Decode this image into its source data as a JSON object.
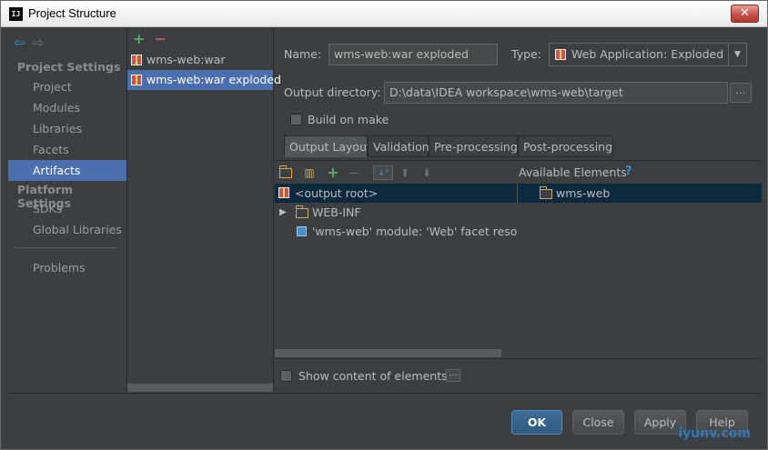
{
  "window": {
    "title": "Project Structure",
    "app_icon_text": "IJ",
    "close_glyph": "✕"
  },
  "nav": {
    "back_glyph": "⇦",
    "forward_glyph": "⇨",
    "project_settings_header": "Project Settings",
    "project_settings_items": [
      "Project",
      "Modules",
      "Libraries",
      "Facets",
      "Artifacts"
    ],
    "platform_settings_header": "Platform Settings",
    "platform_settings_items": [
      "SDKs",
      "Global Libraries"
    ],
    "other_items": [
      "Problems"
    ],
    "selected": "Artifacts"
  },
  "artifacts": {
    "add_glyph": "+",
    "remove_glyph": "−",
    "items": [
      "wms-web:war",
      "wms-web:war exploded"
    ],
    "selected": "wms-web:war exploded"
  },
  "form": {
    "name_label": "Name:",
    "name_value": "wms-web:war exploded",
    "type_label": "Type:",
    "type_value": "Web Application: Exploded",
    "type_dropdown_glyph": "▼",
    "output_dir_label": "Output directory:",
    "output_dir_value": "D:\\data\\IDEA workspace\\wms-web\\target",
    "browse_glyph": "...",
    "build_on_make_label": "Build on make",
    "build_on_make_checked": false
  },
  "tabs": [
    "Output Layout",
    "Validation",
    "Pre-processing",
    "Post-processing"
  ],
  "active_tab": "Output Layout",
  "layout_toolbar": {
    "icons": [
      "new-folder-icon",
      "archive-icon",
      "add-icon",
      "remove-icon",
      "sort-icon",
      "move-up-icon",
      "move-down-icon"
    ],
    "add_glyph": "+",
    "remove_glyph": "—",
    "sort_glyph": "↓ᶻ",
    "up_glyph": "⬆",
    "down_glyph": "⬇",
    "available_label": "Available Elements",
    "help_glyph": "?"
  },
  "output_tree": [
    {
      "label": "<output root>",
      "icon": "artifact-icon",
      "selected": true
    },
    {
      "label": "WEB-INF",
      "icon": "folder-icon",
      "expand_glyph": "▶"
    },
    {
      "label": "'wms-web' module: 'Web' facet resour",
      "icon": "web-facet-icon"
    }
  ],
  "available_tree": [
    {
      "label": "wms-web",
      "icon": "folder-icon"
    }
  ],
  "show_content_label": "Show content of elements",
  "show_content_button_glyph": "...",
  "buttons": {
    "ok": "OK",
    "close": "Close",
    "apply": "Apply",
    "help": "Help"
  },
  "watermark": "iyunv.com",
  "colors": {
    "selection": "#4b6eaf",
    "background": "#3c3f41",
    "tree_selection": "#0d293e",
    "accent": "#3592c4"
  }
}
